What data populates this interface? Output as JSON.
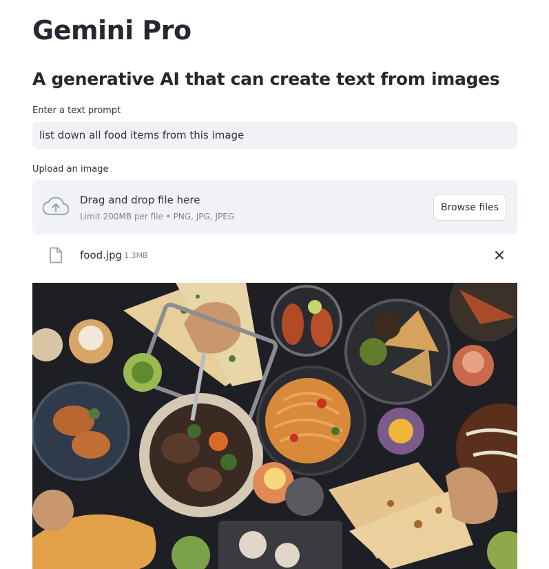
{
  "page": {
    "title": "Gemini Pro",
    "subtitle": "A generative AI that can create text from images"
  },
  "prompt": {
    "label": "Enter a text prompt",
    "value": "list down all food items from this image"
  },
  "uploader": {
    "label": "Upload an image",
    "drop_text": "Drag and drop file here",
    "limit_text": "Limit 200MB per file • PNG, JPG, JPEG",
    "browse_label": "Browse files",
    "icon": "cloud-upload-icon"
  },
  "uploaded_file": {
    "name": "food.jpg",
    "size": "1.3MB",
    "icon": "file-icon",
    "remove_icon": "close-icon"
  },
  "preview": {
    "description_icon": "food-photo"
  },
  "colors": {
    "input_bg": "#f0f2f6",
    "text": "#31333f",
    "muted": "#808495",
    "icon": "#a3a8b8"
  }
}
